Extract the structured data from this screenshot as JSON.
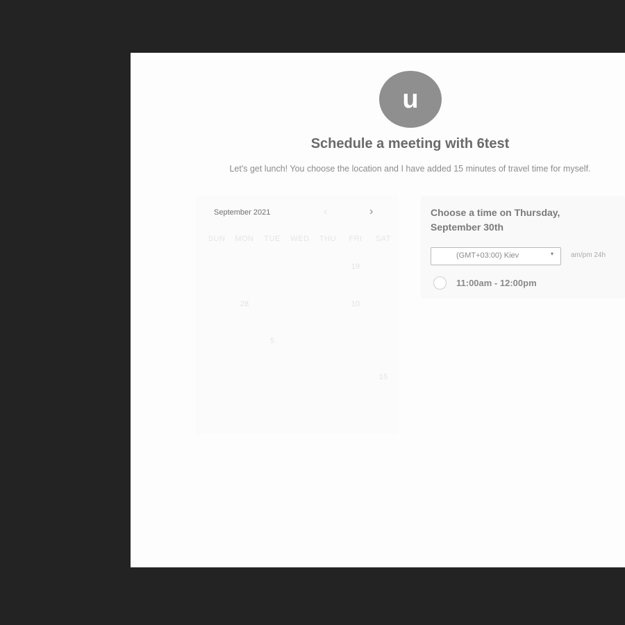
{
  "host": {
    "avatar_initial": "u",
    "title": "Schedule a meeting with 6test",
    "description": "Let's get lunch! You choose the location and I have added 15 minutes of travel time for myself."
  },
  "calendar": {
    "month_label": "September 2021",
    "prev_icon": "chevron-left-icon",
    "next_icon": "chevron-right-icon",
    "prev_glyph": "‹",
    "next_glyph": "›",
    "weekdays": [
      "SUN",
      "MON",
      "TUE",
      "WED",
      "THU",
      "FRI",
      "SAT"
    ],
    "days": [
      "19",
      "28",
      "10",
      "5",
      "15"
    ]
  },
  "time_picker": {
    "heading": "Choose a time on Thursday, September 30th",
    "timezone": "(GMT+03:00) Kiev",
    "timezone_caret": "▾",
    "format_toggle": "am/pm  24h",
    "slots": [
      "11:00am - 12:00pm"
    ]
  },
  "colors": {
    "backdrop": "#232323",
    "panel": "#fdfdfd",
    "avatar": "#8f8f8f"
  }
}
